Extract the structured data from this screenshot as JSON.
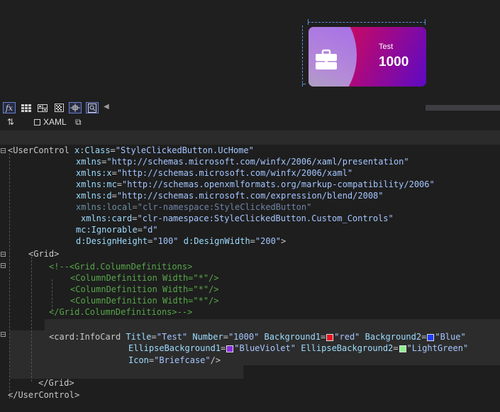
{
  "designer": {
    "card": {
      "title": "Test",
      "number": "1000"
    }
  },
  "toolbar": {
    "fx_label": "fx",
    "buttons": [
      "grid-icon",
      "table-icon",
      "pattern-icon",
      "snap-icon",
      "zoom-fit-icon"
    ]
  },
  "tabbar": {
    "xaml_tab": "XAML",
    "swap_glyph": "⇅",
    "popout_glyph": "⧉"
  },
  "code": {
    "l1": {
      "open": "<",
      "tag": "UserControl",
      "a1": "x",
      "c": ":",
      "a2": "Class",
      "eq": "=",
      "v": "\"StyleClickedButton.UcHome\""
    },
    "l2": {
      "a": "xmlns",
      "eq": "=",
      "v": "\"http://schemas.microsoft.com/winfx/2006/xaml/presentation\""
    },
    "l3": {
      "a": "xmlns:x",
      "eq": "=",
      "v": "\"http://schemas.microsoft.com/winfx/2006/xaml\""
    },
    "l4": {
      "a": "xmlns:mc",
      "eq": "=",
      "v": "\"http://schemas.openxmlformats.org/markup-compatibility/2006\""
    },
    "l5": {
      "a": "xmlns:d",
      "eq": "=",
      "v": "\"http://schemas.microsoft.com/expression/blend/2008\""
    },
    "l6": {
      "a": "xmlns:local",
      "eq": "=",
      "v": "\"clr-namespace:StyleClickedButton\""
    },
    "l7": {
      "a": "xmlns:card",
      "eq": "=",
      "v": "\"clr-namespace:StyleClickedButton.Custom_Controls\""
    },
    "l8": {
      "a": "mc:Ignorable",
      "eq": "=",
      "v": "\"d\""
    },
    "l9": {
      "a1": "d:DesignHeight",
      "eq1": "=",
      "v1": "\"100\"",
      "a2": "d:DesignWidth",
      "eq2": "=",
      "v2": "\"200\"",
      "close": ">"
    },
    "l10": {
      "open": "<",
      "tag": "Grid",
      "close": ">"
    },
    "l11": "<!--<Grid.ColumnDefinitions>",
    "l12": "<ColumnDefinition Width=\"*\"/>",
    "l13": "<ColumnDefinition Width=\"*\"/>",
    "l14": "<ColumnDefinition Width=\"*\"/>",
    "l15": "</Grid.ColumnDefinitions>-->",
    "l16": {
      "open": "<",
      "prefix": "card",
      "colon": ":",
      "tag": "InfoCard",
      "a1": "Title",
      "v1": "\"Test\"",
      "a2": "Number",
      "v2": "\"1000\"",
      "a3": "Background1",
      "v3": "\"red\"",
      "a4": "Background2",
      "v4": "\"Blue\""
    },
    "l17": {
      "a1": "EllipseBackground1",
      "v1": "\"BlueViolet\"",
      "a2": "EllipseBackground2",
      "v2": "\"LightGreen\""
    },
    "l18": {
      "a": "Icon",
      "v": "\"Briefcase\"",
      "close": "/>"
    },
    "l19": {
      "open": "</",
      "tag": "Grid",
      "close": ">"
    },
    "l20": {
      "open": "</",
      "tag": "UserControl",
      "close": ">"
    },
    "eq": "="
  },
  "colors": {
    "red": "#e81123",
    "blue": "#1a3cff",
    "blueviolet": "#8a2be2",
    "lightgreen": "#90ee90",
    "accent": "#5a8fd6"
  }
}
